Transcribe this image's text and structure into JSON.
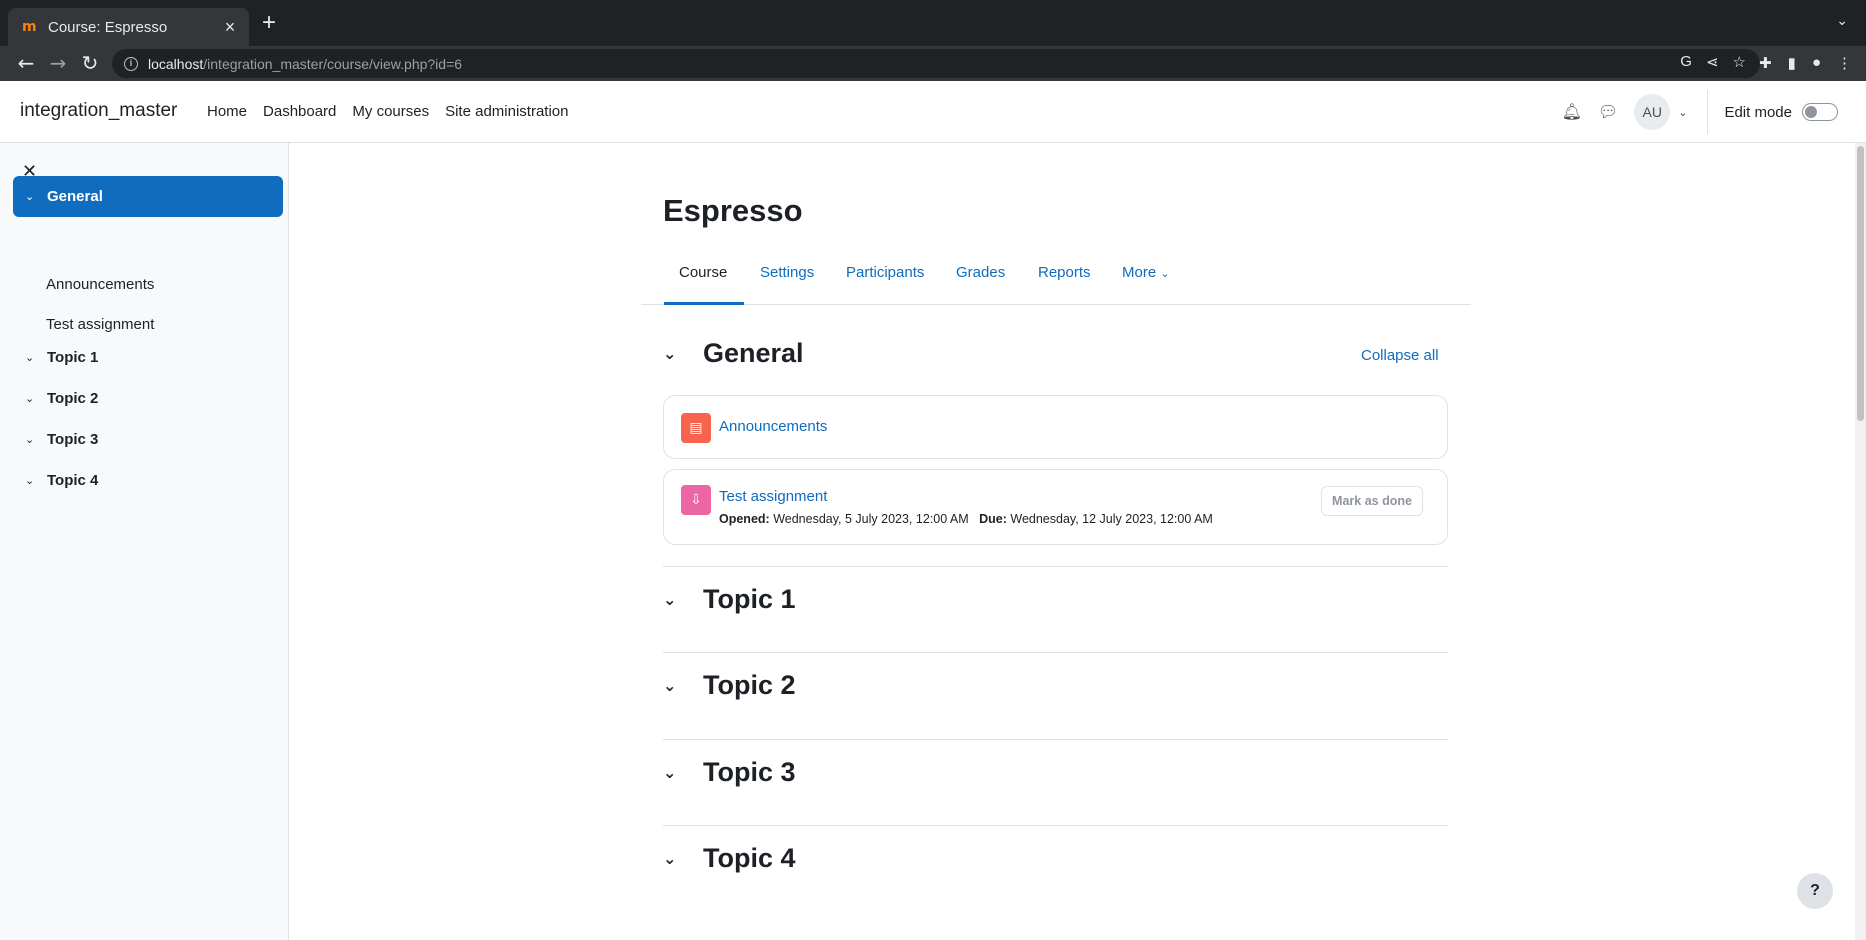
{
  "browser": {
    "tab_title": "Course: Espresso",
    "favicon": "m",
    "url_host": "localhost",
    "url_path": "/integration_master/course/view.php?id=6"
  },
  "navbar": {
    "brand": "integration_master",
    "links": [
      "Home",
      "Dashboard",
      "My courses",
      "Site administration"
    ],
    "avatar_initials": "AU",
    "edit_mode_label": "Edit mode",
    "edit_mode_on": false
  },
  "course_index": {
    "items": [
      {
        "label": "General",
        "active": true
      },
      {
        "label": "Announcements"
      },
      {
        "label": "Test assignment"
      },
      {
        "label": "Topic 1"
      },
      {
        "label": "Topic 2"
      },
      {
        "label": "Topic 3"
      },
      {
        "label": "Topic 4"
      }
    ]
  },
  "course": {
    "title": "Espresso",
    "tabs": [
      "Course",
      "Settings",
      "Participants",
      "Grades",
      "Reports",
      "More"
    ],
    "active_tab": "Course",
    "collapse_all": "Collapse all",
    "sections": [
      "General",
      "Topic 1",
      "Topic 2",
      "Topic 3",
      "Topic 4"
    ],
    "activities": [
      {
        "name": "Announcements",
        "type": "forum",
        "color": "#f7634d"
      },
      {
        "name": "Test assignment",
        "type": "assignment",
        "color": "#eb66a2",
        "opened_label": "Opened:",
        "opened": "Wednesday, 5 July 2023, 12:00 AM",
        "due_label": "Due:",
        "due": "Wednesday, 12 July 2023, 12:00 AM",
        "completion_button": "Mark as done"
      }
    ]
  },
  "help": "?"
}
